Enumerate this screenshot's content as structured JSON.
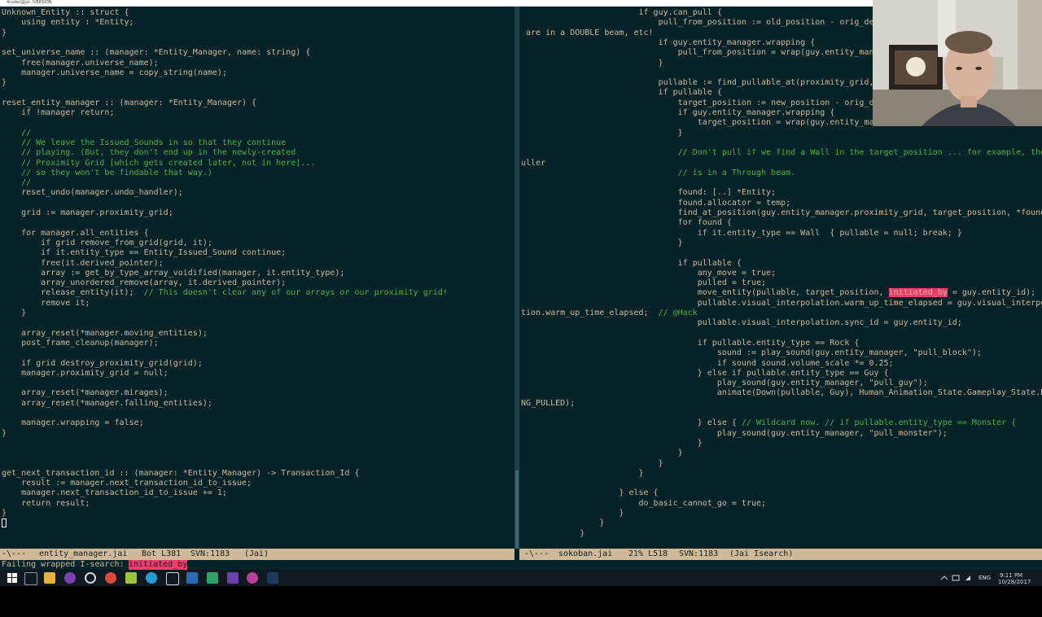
{
  "window": {
    "title": "4coder@Jai: /VERSION"
  },
  "editor": {
    "left_pane": {
      "lines": [
        "Unknown_Entity :: struct {",
        "    using entity : *Entity;",
        "}",
        "",
        "set_universe_name :: (manager: *Entity_Manager, name: string) {",
        "    free(manager.universe_name);",
        "    manager.universe_name = copy_string(name);",
        "}",
        "",
        "reset_entity_manager :: (manager: *Entity_Manager) {",
        "    if !manager return;",
        "",
        "    //",
        "    // We leave the Issued_Sounds in so that they continue",
        "    // playing. (But, they don't end up in the newly-created",
        "    // Proximity Grid [which gets created later, not in here]...",
        "    // so they won't be findable that way.)",
        "    //",
        "    reset_undo(manager.undo_handler);",
        "",
        "    grid := manager.proximity_grid;",
        "",
        "    for manager.all_entities {",
        "        if grid remove_from_grid(grid, it);",
        "        if it.entity_type == Entity_Issued_Sound continue;",
        "        free(it.derived_pointer);",
        "        array := get_by_type_array_voidified(manager, it.entity_type);",
        "        array_unordered_remove(array, it.derived_pointer);",
        "        release_entity(it);  ",
        "        remove it;",
        "    }",
        "",
        "    array_reset(*manager.moving_entities);",
        "    post_frame_cleanup(manager);",
        "",
        "    if grid destroy_proximity_grid(grid);",
        "    manager.proximity_grid = null;",
        "",
        "    array_reset(*manager.mirages);",
        "    array_reset(*manager.falling_entities);",
        "",
        "    manager.wrapping = false;",
        "}",
        "",
        "",
        "",
        "get_next_transaction_id :: (manager: *Entity_Manager) -> Transaction_Id {",
        "    result := manager.next_transaction_id_to_issue;",
        "    manager.next_transaction_id_to_issue += 1;",
        "    return result;",
        "}"
      ],
      "inline_comment": "// This doesn't clear any of our arrays or our proximity grid!"
    },
    "right_pane": {
      "lines": [
        "                        if guy.can_pull {",
        "                            pull_from_position := old_position - orig_delta;",
        " are in a DOUBLE beam, etc!",
        "                            if guy.entity_manager.wrapping {",
        "                                pull_from_position = wrap(guy.entity_manager",
        "                            }",
        "",
        "                            pullable := find_pullable_at(proximity_grid, pul",
        "                            if pullable {",
        "                                target_position := new_position - orig_delta",
        "                                if guy.entity_manager.wrapping {",
        "                                    target_position = wrap(guy.entity_manage",
        "                                }",
        "",
        "                                // Don't pull if we find a Wall in the target_position ... for example, the p",
        "uller",
        "                                // is in a Through beam.",
        "",
        "                                found: [..] *Entity;",
        "                                found.allocator = temp;",
        "                                find_at_position(guy.entity_manager.proximity_grid, target_position, *found);",
        "                                for found {",
        "                                    if it.entity_type == Wall  { pullable = null; break; }",
        "                                }",
        "",
        "                                if pullable {",
        "                                    any_move = true;",
        "                                    pulled = true;",
        "                                    move_entity(pullable, target_position, ",
        "                                    pullable.visual_interpolation.warm_up_time_elapsed = guy.visual_interpola",
        "tion.warm_up_time_elapsed;  ",
        "                                    pullable.visual_interpolation.sync_id = guy.entity_id;",
        "",
        "                                    if pullable.entity_type == Rock {",
        "                                        sound := play_sound(guy.entity_manager, \"pull_block\");",
        "                                        if sound sound.volume_scale *= 0.25;",
        "                                    } else if pullable.entity_type == Guy {",
        "                                        play_sound(guy.entity_manager, \"pull_guy\");",
        "                                        animate(Down(pullable, Guy), Human_Animation_State.Gameplay_State.BEI",
        "NG_PULLED);",
        "",
        "                                    } else { ",
        "                                        play_sound(guy.entity_manager, \"pull_monster\");",
        "                                    }",
        "                                }",
        "                            }",
        "                        }",
        "",
        "                    } else {",
        "                        do_basic_cannot_go = true;",
        "                    }",
        "                }",
        "            }",
        "",
        "            if do_basic_cannot_go {"
      ],
      "search_match": "initiated_by",
      "after_match": " = guy.entity_id);",
      "hack_comment": "// @Hack",
      "wildcard_comment": "// Wildcard now. // if pullable.entity_type == Monster {"
    }
  },
  "modeline_left": {
    "status": "-\\---",
    "filename": "entity_manager.jai",
    "position": "Bot L381",
    "svn": "SVN:1183",
    "mode": "(Jai)"
  },
  "modeline_right": {
    "status": "-\\---",
    "filename": "sokoban.jai",
    "position": "21% L518",
    "svn": "SVN:1183",
    "mode": "(Jai Isearch)"
  },
  "minibuffer": {
    "label": "Failing wrapped I-search:",
    "query": "initiated_by"
  },
  "taskbar": {
    "tray_lang": "ENG",
    "time": "9:11 PM",
    "date": "10/28/2017"
  },
  "colors": {
    "background": "#062329",
    "text": "#d1b897",
    "comment": "#44b340",
    "search_highlight": "#f33a6a",
    "modeline": "#d1b897"
  }
}
